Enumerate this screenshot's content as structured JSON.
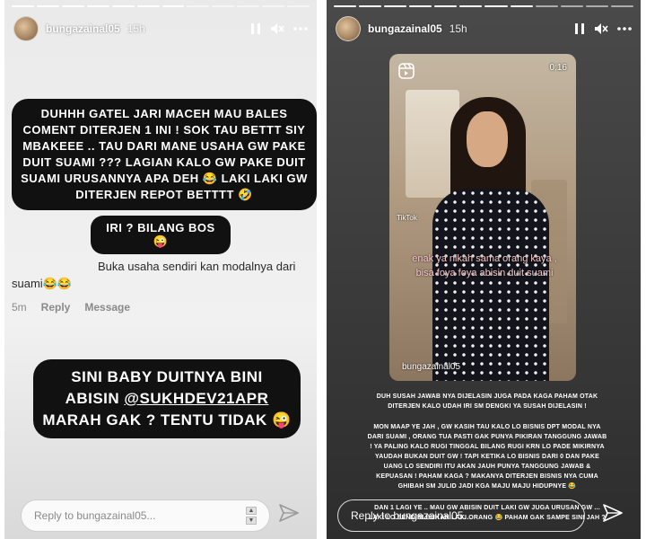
{
  "left_story": {
    "username": "bungazainal05",
    "time": "15h",
    "bubble_main": "DUHHH GATEL JARI MACEH MAU BALES COMENT DITERJEN 1 INI ! SOK TAU BETTT SIY MBAKEEE .. TAU DARI MANE USAHA GW PAKE DUIT SUAMI ??? LAGIAN KALO GW PAKE DUIT SUAMI URUSANNYA APA DEH 😂 LAKI LAKI GW DITERJEN REPOT BETTTT 🤣",
    "bubble_iri": "IRI ? BILANG BOS 😜",
    "comment": {
      "text": "Buka usaha sendiri kan modalnya dari suami😂😂",
      "time": "5m",
      "reply": "Reply",
      "message": "Message"
    },
    "bubble_baby_line1": "SINI BABY DUITNYA BINI",
    "bubble_baby_line2_prefix": "ABISIN ",
    "bubble_baby_mention": "@SUKHDEV21APR",
    "bubble_baby_line3": "MARAH GAK ? TENTU TIDAK 😜",
    "reply_placeholder": "Reply to bungazainal05..."
  },
  "right_story": {
    "username": "bungazainal05",
    "time": "15h",
    "video": {
      "duration": "0:16",
      "tiktok_label": "TikTok",
      "overlay_caption": "enak ya nikah sama orang kaya , bisa foya foya abisin duit suami",
      "video_user": "bungazainal05"
    },
    "caption1": "DUH SUSAH JAWAB NYA DIJELASIN JUGA PADA KAGA PAHAM OTAK DITERJEN KALO UDAH IRI SM DENGKI YA SUSAH DIJELASIN !",
    "caption2": "MON MAAP YE JAH , GW KASIH TAU KALO LO BISNIS DPT MODAL NYA DARI SUAMI , ORANG TUA PASTI GAK PUNYA PIKIRAN TANGGUNG JAWAB ! YA PALING KALO RUGI TINGGAL BILANG RUGI KRN LO PADE MIKIRNYA YAUDAH BUKAN DUIT GW ! TAPI KETIKA LO BISNIS DARI 0 DAN PAKE UANG LO SENDIRI ITU AKAN JAUH PUNYA TANGGUNG JAWAB & KEPUASAN ! PAHAM KAGA ? MAKANYA DITERJEN BISNIS NYA CUMA GHIBAH SM JULID JADI KGA MAJU MAJU HIDUPNYE 😂",
    "caption3": "DAN 1 LAGI YE .. MAU GW ABISIN DUIT LAKI GW JUGA URUSAN GW ... LAKI LO SENDIRI BUKAN LAKI ORANG 😂 PAHAM GAK SAMPE SINI JAH ?",
    "reply_placeholder": "Reply to bungazainal05..."
  },
  "icons": [
    "pause-icon",
    "mute-icon",
    "more-icon",
    "send-icon",
    "reels-icon"
  ]
}
